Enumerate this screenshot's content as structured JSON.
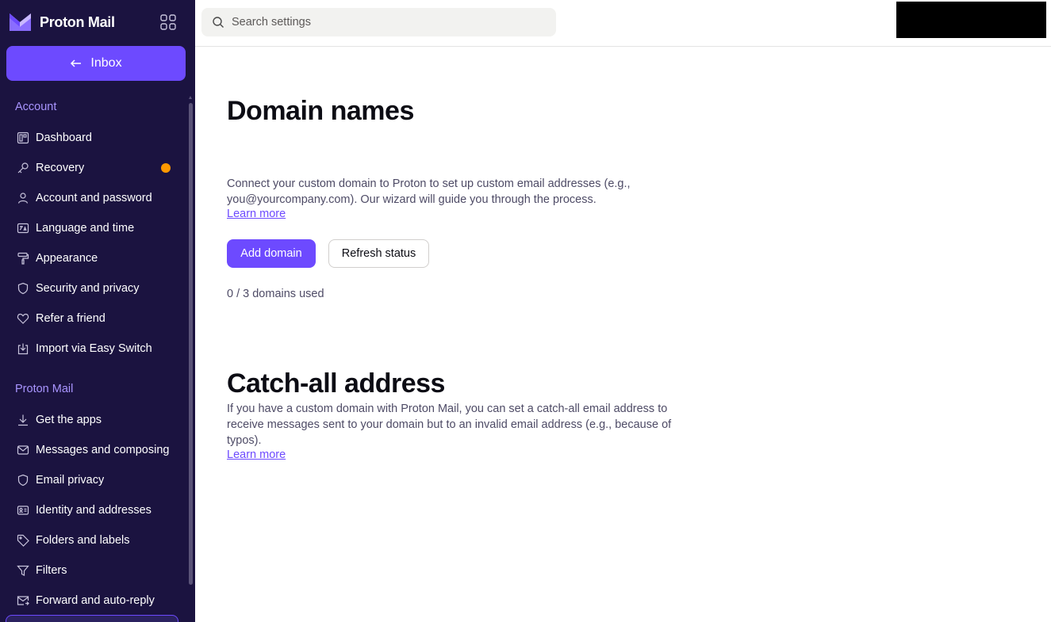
{
  "brand": {
    "name": "Proton Mail",
    "accent": "#6d4aff",
    "sidebar_bg": "#1b1340"
  },
  "inbox_button": {
    "label": "Inbox"
  },
  "search": {
    "placeholder": "Search settings"
  },
  "sections": {
    "account": {
      "title": "Account",
      "items": [
        {
          "label": "Dashboard",
          "icon": "dashboard-icon"
        },
        {
          "label": "Recovery",
          "icon": "key-icon",
          "badge": "warning-dot"
        },
        {
          "label": "Account and password",
          "icon": "user-icon"
        },
        {
          "label": "Language and time",
          "icon": "language-icon"
        },
        {
          "label": "Appearance",
          "icon": "paint-roller-icon"
        },
        {
          "label": "Security and privacy",
          "icon": "shield-icon"
        },
        {
          "label": "Refer a friend",
          "icon": "heart-icon"
        },
        {
          "label": "Import via Easy Switch",
          "icon": "import-icon"
        }
      ]
    },
    "mail": {
      "title": "Proton Mail",
      "items": [
        {
          "label": "Get the apps",
          "icon": "download-icon"
        },
        {
          "label": "Messages and composing",
          "icon": "envelope-icon"
        },
        {
          "label": "Email privacy",
          "icon": "shield-icon"
        },
        {
          "label": "Identity and addresses",
          "icon": "id-card-icon"
        },
        {
          "label": "Folders and labels",
          "icon": "tag-icon"
        },
        {
          "label": "Filters",
          "icon": "filter-icon"
        },
        {
          "label": "Forward and auto-reply",
          "icon": "forward-envelope-icon"
        }
      ]
    }
  },
  "main": {
    "domains": {
      "title": "Domain names",
      "description": "Connect your custom domain to Proton to set up custom email addresses (e.g., you@yourcompany.com). Our wizard will guide you through the process.",
      "learn_more": "Learn more",
      "add_button": "Add domain",
      "refresh_button": "Refresh status",
      "usage": "0 / 3 domains used"
    },
    "catch_all": {
      "title": "Catch-all address",
      "description": "If you have a custom domain with Proton Mail, you can set a catch-all email address to receive messages sent to your domain but to an invalid email address (e.g., because of typos).",
      "learn_more": "Learn more"
    }
  }
}
